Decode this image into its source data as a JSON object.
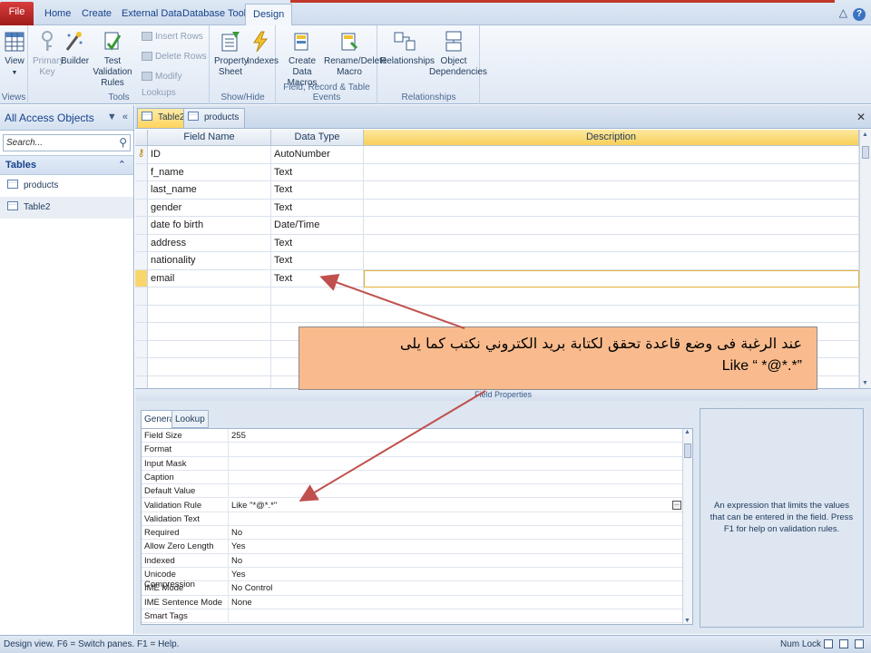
{
  "ribbon_tabs": [
    "File",
    "Home",
    "Create",
    "External Data",
    "Database Tools",
    "Design"
  ],
  "active_tab": "Design",
  "groups": {
    "views": {
      "label": "Views",
      "view_label": "View"
    },
    "tools": {
      "label": "Tools",
      "primary_key": "Primary Key",
      "builder": "Builder",
      "test_validation": "Test Validation Rules",
      "insert_rows": "Insert Rows",
      "delete_rows": "Delete Rows",
      "modify_lookups": "Modify Lookups"
    },
    "show_hide": {
      "label": "Show/Hide",
      "property_sheet": "Property Sheet",
      "indexes": "Indexes"
    },
    "field_events": {
      "label": "Field, Record & Table Events",
      "create_macros": "Create Data Macros",
      "rename_macro": "Rename/Delete Macro"
    },
    "relationships": {
      "label": "Relationships",
      "relationships_btn": "Relationships",
      "object_deps": "Object Dependencies"
    }
  },
  "nav": {
    "title": "All Access Objects",
    "search_placeholder": "Search...",
    "section": "Tables",
    "items": [
      "products",
      "Table2"
    ]
  },
  "doc_tabs": [
    "Table2",
    "products"
  ],
  "grid": {
    "headers": {
      "field": "Field Name",
      "type": "Data Type",
      "desc": "Description"
    },
    "rows": [
      {
        "name": "ID",
        "type": "AutoNumber"
      },
      {
        "name": "f_name",
        "type": "Text"
      },
      {
        "name": "last_name",
        "type": "Text"
      },
      {
        "name": "gender",
        "type": "Text"
      },
      {
        "name": "date fo birth",
        "type": "Date/Time"
      },
      {
        "name": "address",
        "type": "Text"
      },
      {
        "name": "nationality",
        "type": "Text"
      },
      {
        "name": "email",
        "type": "Text"
      }
    ]
  },
  "callout": {
    "line1": "عند الرغبة فى وضع قاعدة تحقق لكتابة بريد الكتروني  نكتب كما يلى",
    "line2": "Like “ *@*.*”"
  },
  "field_properties": {
    "bar_label": "Field Properties",
    "tabs": [
      "General",
      "Lookup"
    ],
    "rows": [
      {
        "label": "Field Size",
        "value": "255"
      },
      {
        "label": "Format",
        "value": ""
      },
      {
        "label": "Input Mask",
        "value": ""
      },
      {
        "label": "Caption",
        "value": ""
      },
      {
        "label": "Default Value",
        "value": ""
      },
      {
        "label": "Validation Rule",
        "value": "Like \"*@*.*\""
      },
      {
        "label": "Validation Text",
        "value": ""
      },
      {
        "label": "Required",
        "value": "No"
      },
      {
        "label": "Allow Zero Length",
        "value": "Yes"
      },
      {
        "label": "Indexed",
        "value": "No"
      },
      {
        "label": "Unicode Compression",
        "value": "Yes"
      },
      {
        "label": "IME Mode",
        "value": "No Control"
      },
      {
        "label": "IME Sentence Mode",
        "value": "None"
      },
      {
        "label": "Smart Tags",
        "value": ""
      }
    ],
    "help": "An expression that limits the values that can be entered in the field. Press F1 for help on validation rules."
  },
  "status": {
    "left": "Design view.  F6 = Switch panes.  F1 = Help.",
    "num_lock": "Num Lock"
  },
  "colors": {
    "file_tab": "#c42b2b",
    "callout": "#f9bb8d",
    "arrow": "#c0504d",
    "desc_header": "#f8cf58"
  }
}
